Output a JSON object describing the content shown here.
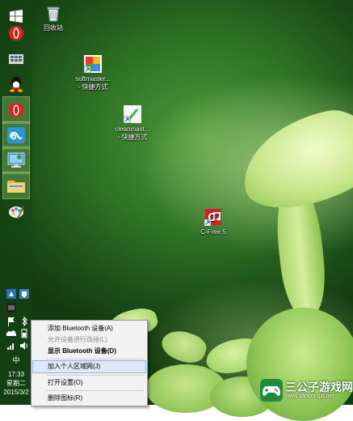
{
  "taskbar": {
    "pinned": [
      {
        "name": "windows-start",
        "label": ""
      },
      {
        "name": "opera",
        "label": ""
      },
      {
        "name": "app-grid",
        "label": ""
      },
      {
        "name": "qq",
        "label": ""
      },
      {
        "name": "opera",
        "label": ""
      },
      {
        "name": "link-app",
        "label": ""
      },
      {
        "name": "remote-desktop",
        "label": ""
      },
      {
        "name": "file-explorer",
        "label": ""
      },
      {
        "name": "paint",
        "label": ""
      }
    ],
    "clock": {
      "time": "17:33",
      "day": "星期二",
      "date": "2015/3/2"
    },
    "tray_input": "中"
  },
  "desktop": {
    "icons": [
      {
        "label": "回收站",
        "icon": "recycle-bin-icon"
      },
      {
        "label_line1": "softmaster...",
        "label_line2": "- 快捷方式",
        "icon": "softmaster-shortcut-icon"
      },
      {
        "label_line1": "cleanmast...",
        "label_line2": "- 快捷方式",
        "icon": "cleanmaster-shortcut-icon"
      },
      {
        "label": "C-Free 5",
        "icon": "cfree-icon"
      }
    ]
  },
  "context_menu": {
    "items": [
      {
        "label": "添加 Bluetooth 设备(A)",
        "state": "normal"
      },
      {
        "label": "允许设备进行连接(L)",
        "state": "disabled"
      },
      {
        "label": "显示 Bluetooth 设备(D)",
        "state": "bold"
      },
      {
        "label": "加入个人区域网(J)",
        "state": "selected"
      },
      {
        "label": "打开设置(O)",
        "state": "normal"
      },
      {
        "label": "删除图标(R)",
        "state": "normal"
      }
    ]
  },
  "watermark": {
    "title": "三公子游戏网",
    "url": "www.sangongzi.net"
  }
}
